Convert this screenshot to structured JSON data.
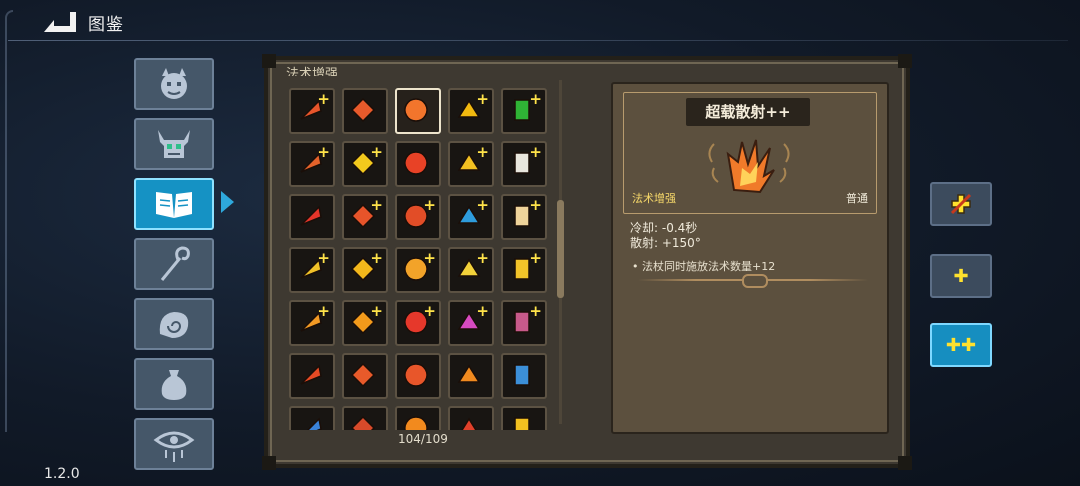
{
  "header": {
    "title": "图鉴",
    "version": "1.2.0"
  },
  "categories": [
    {
      "name": "monsters",
      "icon": "demon-face-icon"
    },
    {
      "name": "bosses",
      "icon": "horned-skull-icon"
    },
    {
      "name": "spellbook",
      "icon": "open-book-icon",
      "active": true
    },
    {
      "name": "staffs",
      "icon": "staff-icon"
    },
    {
      "name": "relics",
      "icon": "swirl-hand-icon"
    },
    {
      "name": "potions",
      "icon": "pouch-icon"
    },
    {
      "name": "curses",
      "icon": "eye-icon"
    }
  ],
  "grid": {
    "section_title": "法术增强",
    "counter": "104/109",
    "items": [
      {
        "icon": "twin-arrows-icon",
        "color": "#e8552b",
        "plus": true
      },
      {
        "icon": "spread-arrows-icon",
        "color": "#e85a2b",
        "plus": false
      },
      {
        "icon": "scatter-shot-icon",
        "color": "#f2752c",
        "plus": false,
        "selected": true
      },
      {
        "icon": "gold-burst-icon",
        "color": "#f2b90f",
        "plus": true
      },
      {
        "icon": "green-drop-icon",
        "color": "#2fb335",
        "plus": true
      },
      {
        "icon": "orbit-arrow-icon",
        "color": "#e4622a",
        "plus": true
      },
      {
        "icon": "lightning-icon",
        "color": "#f3c91d",
        "plus": true
      },
      {
        "icon": "pause-icon",
        "color": "#e84226",
        "plus": false
      },
      {
        "icon": "crescent-icon",
        "color": "#f2c021",
        "plus": true
      },
      {
        "icon": "mouse-icon",
        "color": "#e9e6dd",
        "plus": true
      },
      {
        "icon": "target-icon",
        "color": "#e5352a",
        "plus": false
      },
      {
        "icon": "rising-arrow-icon",
        "color": "#e7542a",
        "plus": true
      },
      {
        "icon": "tri-arrow-icon",
        "color": "#e24d27",
        "plus": true
      },
      {
        "icon": "blue-crystal-icon",
        "color": "#2e9cdc",
        "plus": true
      },
      {
        "icon": "larva-icon",
        "color": "#efd39a",
        "plus": true
      },
      {
        "icon": "zigzag-icon",
        "color": "#f0c128",
        "plus": true
      },
      {
        "icon": "up-arrows-icon",
        "color": "#f2b71b",
        "plus": true
      },
      {
        "icon": "four-dots-icon",
        "color": "#f2a329",
        "plus": true
      },
      {
        "icon": "battery-icon",
        "color": "#f2d13a",
        "plus": true
      },
      {
        "icon": "grid-cube-icon",
        "color": "#f2c329",
        "plus": true
      },
      {
        "icon": "chevrons-icon",
        "color": "#f29a24",
        "plus": true
      },
      {
        "icon": "sun-icon",
        "color": "#f39a1b",
        "plus": true
      },
      {
        "icon": "red-flask-icon",
        "color": "#e6382b",
        "plus": true
      },
      {
        "icon": "pink-cube-icon",
        "color": "#d84ac0",
        "plus": true
      },
      {
        "icon": "worm-icon",
        "color": "#c85a8a",
        "plus": true
      },
      {
        "icon": "lotus-icon",
        "color": "#e64a24",
        "plus": false
      },
      {
        "icon": "serpent-icon",
        "color": "#e85a2a",
        "plus": false
      },
      {
        "icon": "cross-ring-icon",
        "color": "#e8562a",
        "plus": false
      },
      {
        "icon": "fire-swirl-icon",
        "color": "#f08a1f",
        "plus": false
      },
      {
        "icon": "vortex-icon",
        "color": "#3c8fd8",
        "plus": false
      },
      {
        "icon": "blue-bars-icon",
        "color": "#3a82d8",
        "plus": false
      },
      {
        "icon": "red-bug-icon",
        "color": "#d84a2a",
        "plus": false
      },
      {
        "icon": "flame-ring-icon",
        "color": "#f28a1e",
        "plus": false
      },
      {
        "icon": "red-spikes-icon",
        "color": "#e0402a",
        "plus": false
      },
      {
        "icon": "gold-gem-icon",
        "color": "#f2c020",
        "plus": false
      }
    ]
  },
  "detail": {
    "name": "超载散射++",
    "category": "法术增强",
    "rarity": "普通",
    "cooldown": "冷却: -0.4秒",
    "spread": "散射: +150°",
    "effect": "•  法杖同时施放法术数量+12",
    "art_icon": "scatter-shot-icon"
  },
  "levels": [
    {
      "name": "level-0",
      "label": "",
      "icon": "slashed-plus-icon"
    },
    {
      "name": "level-1",
      "label": "✚"
    },
    {
      "name": "level-2",
      "label": "✚✚",
      "active": true
    }
  ]
}
